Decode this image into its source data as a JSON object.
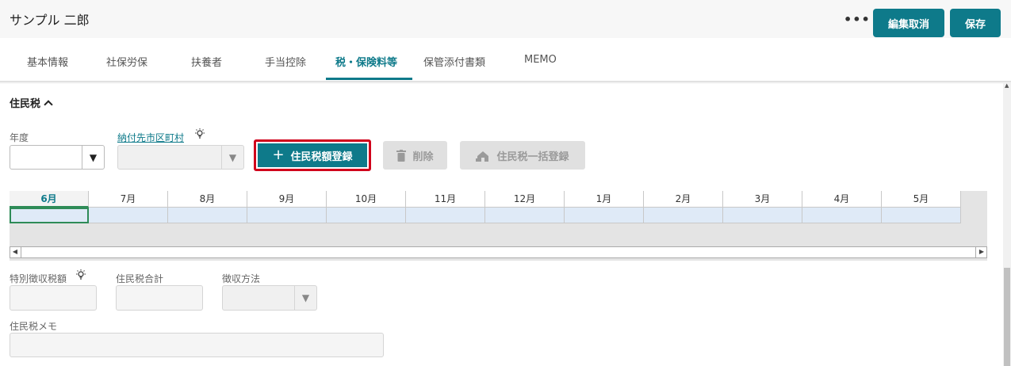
{
  "header": {
    "employee_name": "サンプル 二郎",
    "more_label": "•••",
    "cancel_edit_label": "編集取消",
    "save_label": "保存"
  },
  "tabs": [
    {
      "label": "基本情報"
    },
    {
      "label": "社保労保"
    },
    {
      "label": "扶養者"
    },
    {
      "label": "手当控除"
    },
    {
      "label": "税・保険料等",
      "active": true
    },
    {
      "label": "保管添付書類"
    },
    {
      "label": "MEMO"
    }
  ],
  "section": {
    "title": "住民税"
  },
  "form": {
    "year_label": "年度",
    "year_value": "",
    "municipality_label": "納付先市区町村",
    "municipality_value": "",
    "register_button": "住民税額登録",
    "delete_button": "削除",
    "bulk_register_button": "住民税一括登録"
  },
  "grid": {
    "months": [
      "6月",
      "7月",
      "8月",
      "9月",
      "10月",
      "11月",
      "12月",
      "1月",
      "2月",
      "3月",
      "4月",
      "5月"
    ]
  },
  "fields": {
    "special_collection_label": "特別徴収税額",
    "total_label": "住民税合計",
    "collection_method_label": "徴収方法",
    "memo_label": "住民税メモ"
  },
  "colors": {
    "accent": "#0e7a8a",
    "highlight_border": "#d0021b",
    "selected_cell": "#2e8b57"
  }
}
